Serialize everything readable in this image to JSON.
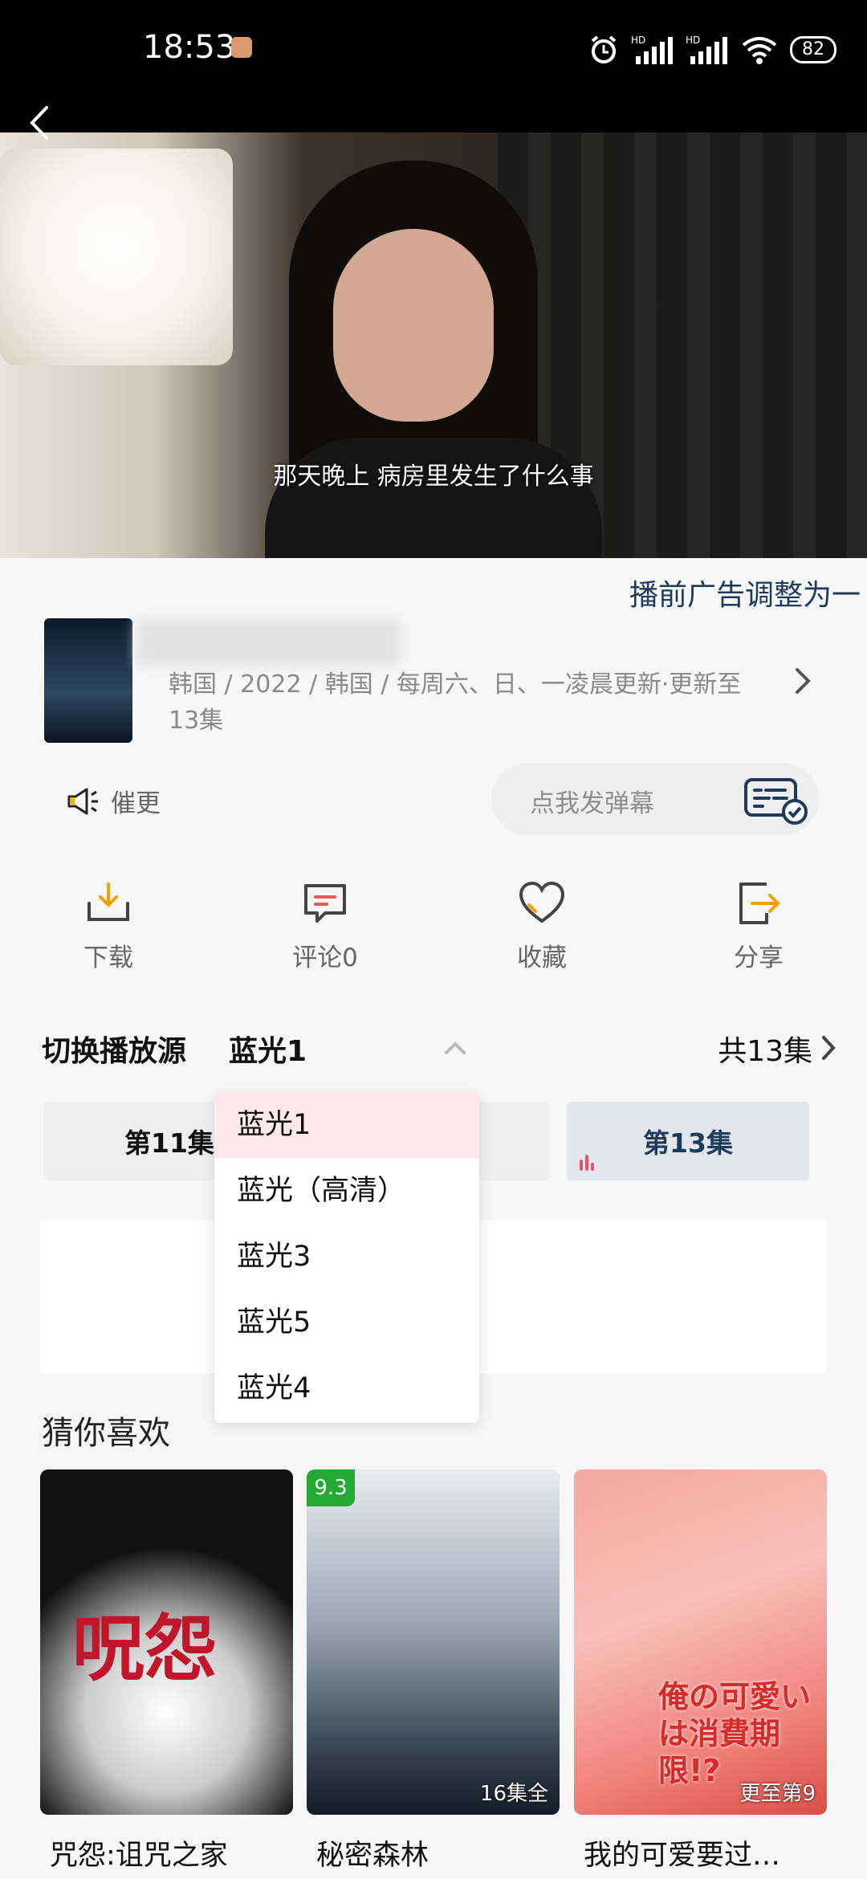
{
  "status_bar": {
    "time": "18:53",
    "battery": "82"
  },
  "video": {
    "subtitle": "那天晚上 病房里发生了什么事"
  },
  "ad_marquee": "播前广告调整为一",
  "show": {
    "meta": "韩国 / 2022 / 韩国 / 每周六、日、一凌晨更新·更新至13集"
  },
  "cuigeng_label": "催更",
  "danmu_placeholder": "点我发弹幕",
  "actions": [
    {
      "label": "下载",
      "icon": "download-icon"
    },
    {
      "label": "评论0",
      "icon": "comment-icon"
    },
    {
      "label": "收藏",
      "icon": "heart-icon"
    },
    {
      "label": "分享",
      "icon": "share-icon"
    }
  ],
  "source": {
    "label": "切换播放源",
    "current": "蓝光1",
    "total": "共13集"
  },
  "episodes": {
    "ep11": "第11集",
    "ep13": "第13集"
  },
  "dropdown": {
    "options": [
      "蓝光1",
      "蓝光（高清）",
      "蓝光3",
      "蓝光5",
      "蓝光4"
    ],
    "selected_index": 0
  },
  "recommend": {
    "title": "猜你喜欢",
    "items": [
      {
        "title": "咒怨:诅咒之家",
        "poster_text": "呪怨",
        "overlay": ""
      },
      {
        "title": "秘密森林",
        "score": "9.3",
        "overlay": "16集全"
      },
      {
        "title": "我的可爱要过…",
        "poster_text": "俺の可愛いは消費期限!?",
        "overlay": "更至第9"
      }
    ]
  },
  "colors": {
    "accent": "#1e3b5c",
    "selected_bg": "#fde9ec",
    "score_badge": "#22aa34"
  }
}
